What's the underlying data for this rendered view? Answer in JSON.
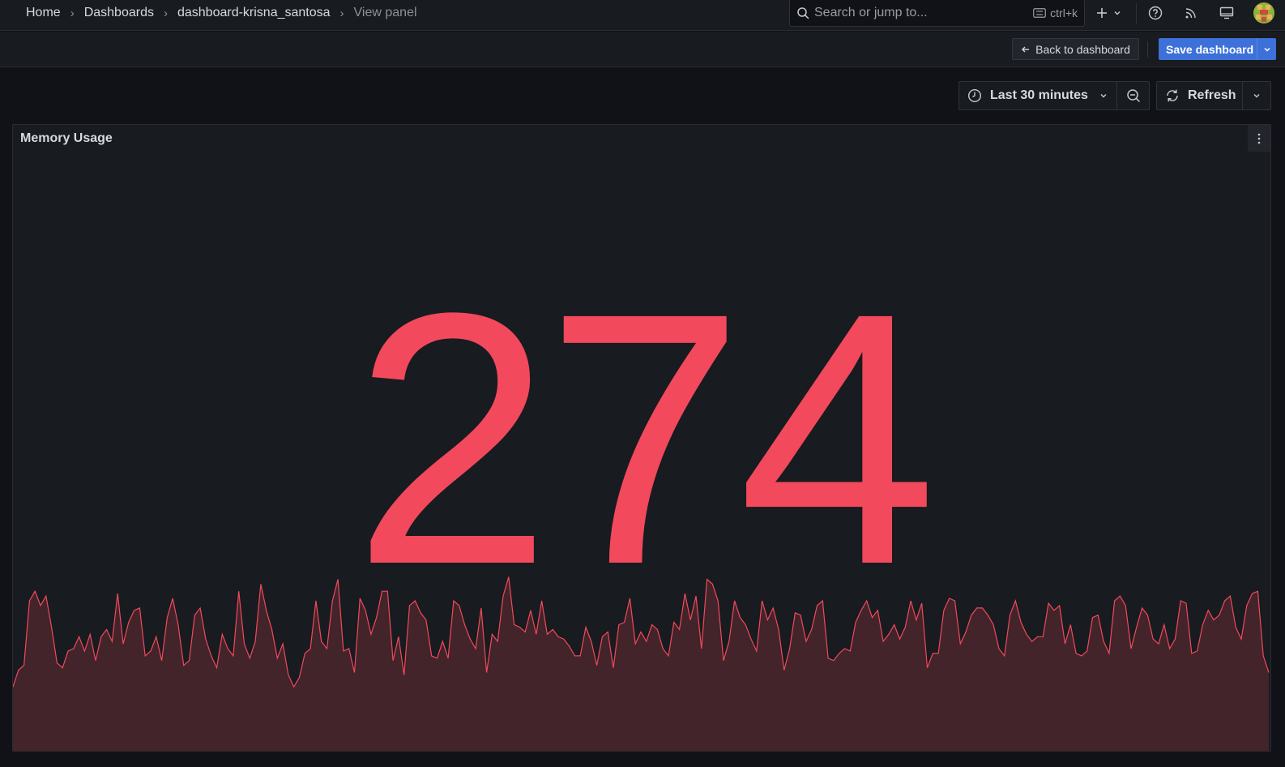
{
  "breadcrumb": {
    "items": [
      "Home",
      "Dashboards",
      "dashboard-krisna_santosa"
    ],
    "current": "View panel"
  },
  "search": {
    "placeholder": "Search or jump to...",
    "shortcut": "ctrl+k"
  },
  "toolbar": {
    "back_label": "Back to dashboard",
    "save_label": "Save dashboard"
  },
  "time": {
    "range_label": "Last 30 minutes",
    "refresh_label": "Refresh"
  },
  "panel": {
    "title": "Memory Usage",
    "value": "274",
    "color": "#f2495c",
    "sparkline": [
      120,
      155,
      165,
      300,
      320,
      290,
      310,
      245,
      170,
      160,
      195,
      200,
      225,
      195,
      230,
      175,
      225,
      240,
      215,
      315,
      210,
      255,
      280,
      285,
      185,
      195,
      225,
      175,
      265,
      305,
      250,
      165,
      175,
      270,
      285,
      220,
      185,
      160,
      230,
      200,
      185,
      320,
      210,
      180,
      215,
      335,
      280,
      240,
      180,
      210,
      145,
      120,
      140,
      190,
      200,
      300,
      215,
      200,
      300,
      345,
      195,
      200,
      150,
      305,
      280,
      230,
      265,
      320,
      320,
      175,
      225,
      145,
      290,
      300,
      275,
      260,
      185,
      180,
      215,
      180,
      300,
      290,
      250,
      220,
      200,
      285,
      150,
      230,
      215,
      310,
      350,
      250,
      245,
      235,
      280,
      230,
      300,
      230,
      240,
      225,
      220,
      205,
      185,
      185,
      245,
      215,
      165,
      225,
      235,
      160,
      250,
      255,
      305,
      210,
      235,
      215,
      250,
      240,
      200,
      185,
      255,
      240,
      315,
      260,
      310,
      200,
      345,
      335,
      300,
      175,
      215,
      300,
      265,
      250,
      220,
      195,
      300,
      260,
      285,
      240,
      155,
      200,
      275,
      270,
      215,
      240,
      290,
      300,
      180,
      175,
      190,
      200,
      195,
      255,
      280,
      300,
      265,
      280,
      215,
      230,
      250,
      220,
      245,
      300,
      260,
      295,
      160,
      190,
      190,
      280,
      305,
      300,
      210,
      235,
      270,
      285,
      285,
      270,
      250,
      200,
      185,
      270,
      300,
      255,
      230,
      215,
      225,
      225,
      295,
      280,
      290,
      210,
      250,
      190,
      185,
      195,
      265,
      270,
      215,
      190,
      300,
      310,
      290,
      200,
      245,
      285,
      270,
      220,
      210,
      250,
      200,
      220,
      300,
      295,
      190,
      195,
      250,
      280,
      260,
      270,
      300,
      310,
      245,
      220,
      290,
      315,
      320,
      185,
      150
    ]
  }
}
